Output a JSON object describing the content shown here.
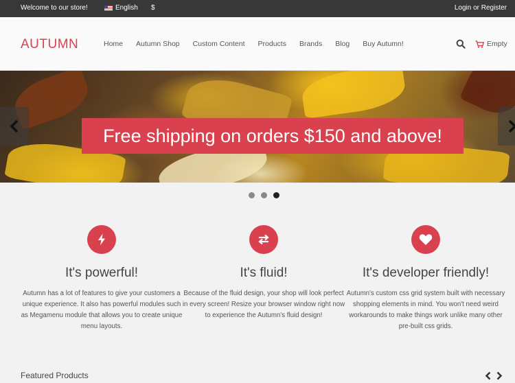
{
  "topbar": {
    "welcome": "Welcome to our store!",
    "language": "English",
    "currency": "$",
    "login": "Login or Register"
  },
  "header": {
    "logo": "AUTUMN",
    "nav": [
      "Home",
      "Autumn Shop",
      "Custom Content",
      "Products",
      "Brands",
      "Blog",
      "Buy Autumn!"
    ],
    "cart_label": "Empty"
  },
  "hero": {
    "promo": "Free shipping on orders $150 and above!",
    "slides_total": 3,
    "active_slide": 3
  },
  "features": [
    {
      "icon": "lightning-icon",
      "title": "It's powerful!",
      "text": "Autumn has a lot of features to give your customers a unique experience. It also has powerful modules such as Megamenu module that allows you to create unique menu layouts."
    },
    {
      "icon": "swap-arrows-icon",
      "title": "It's fluid!",
      "text": "Because of the fluid design, your shop will look perfect in every screen! Resize your browser window right now to experience the Autumn's fluid design!"
    },
    {
      "icon": "heart-icon",
      "title": "It's developer friendly!",
      "text": "Autumn's custom css grid system built with necessary shopping elements in mind. You won't need weird workarounds to make things work unlike many other pre-built css grids."
    }
  ],
  "featured": {
    "title": "Featured Products"
  },
  "colors": {
    "accent": "#d9414e",
    "topbar": "#383838"
  }
}
